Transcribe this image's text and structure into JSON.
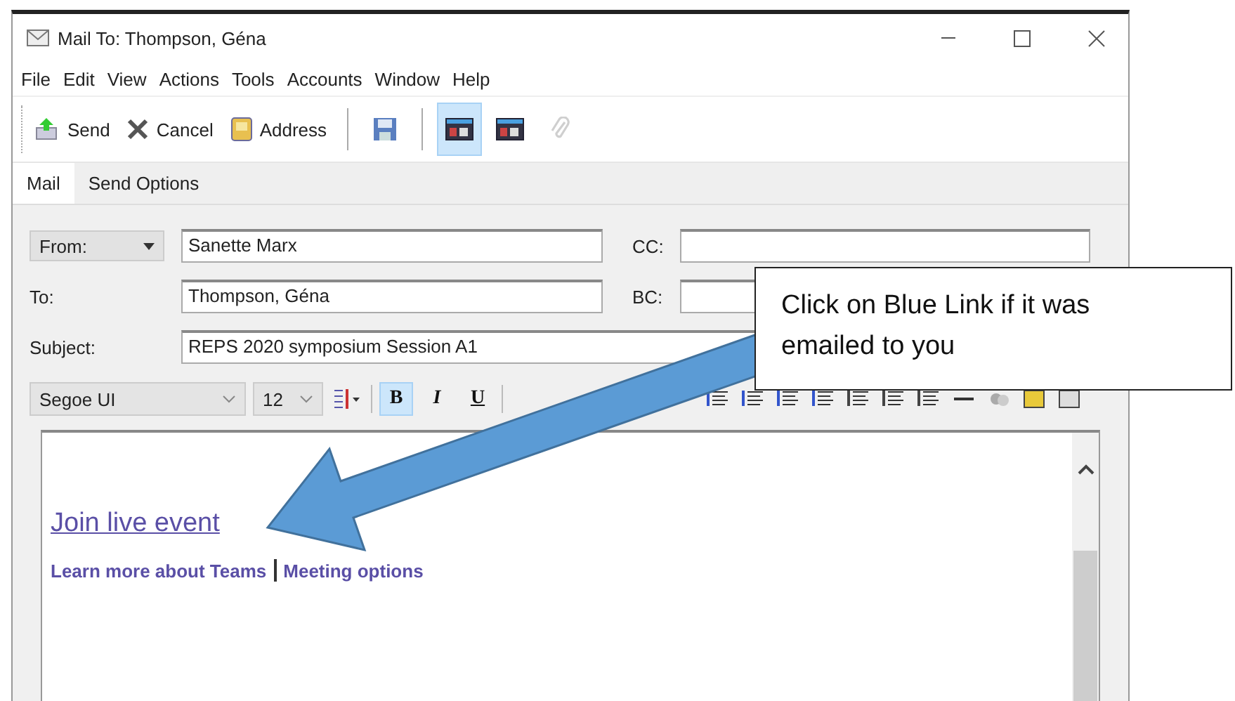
{
  "window": {
    "title": "Mail To: Thompson, Géna"
  },
  "menu": [
    "File",
    "Edit",
    "View",
    "Actions",
    "Tools",
    "Accounts",
    "Window",
    "Help"
  ],
  "toolbar": [
    {
      "kind": "button",
      "label": "Send"
    },
    {
      "kind": "button",
      "label": "Cancel"
    },
    {
      "kind": "button",
      "label": "Address"
    },
    {
      "kind": "separator"
    },
    {
      "kind": "icon",
      "selected": false,
      "disabled": false
    },
    {
      "kind": "separator"
    },
    {
      "kind": "icon",
      "selected": true,
      "disabled": false
    },
    {
      "kind": "icon",
      "selected": false,
      "disabled": false
    },
    {
      "kind": "icon",
      "selected": false,
      "disabled": true
    }
  ],
  "tabs": [
    {
      "label": "Mail",
      "selected": true
    },
    {
      "label": "Send Options",
      "selected": false
    }
  ],
  "from_field": {
    "label": "From:",
    "value": "Sanette Marx"
  },
  "to_field": {
    "label": "To:",
    "value": "Thompson, Géna"
  },
  "subject_field": {
    "label": "Subject:",
    "value": "REPS 2020 symposium Session A1"
  },
  "cc_field": {
    "label": "CC:"
  },
  "bc_field": {
    "label": "BC:"
  },
  "format_bar": {
    "font": "Segoe UI",
    "size": "12",
    "buttons": [
      {
        "label": "B",
        "selected": true
      },
      {
        "label": "I",
        "selected": false
      },
      {
        "label": "U",
        "selected": false
      }
    ]
  },
  "body": {
    "link": "Join live event",
    "footer_links": [
      "Learn more about Teams",
      "Meeting options"
    ]
  },
  "callout": {
    "text": "Click on Blue Link if it was emailed to you"
  }
}
